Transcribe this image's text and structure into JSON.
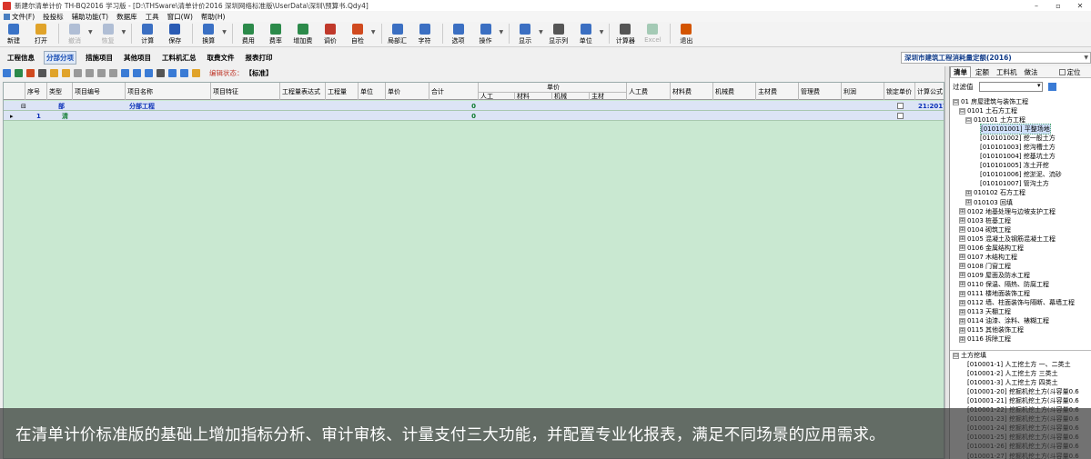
{
  "window": {
    "title": "新建尔清单计价 TH-BQ2016 学习版 - [D:\\THSware\\清单计价2016 深圳网络标准版\\UserData\\深圳\\预算书.Qdy4]",
    "controls": [
      "–",
      "▫",
      "✕"
    ]
  },
  "menu": {
    "items": [
      "文件(F)",
      "投投标",
      "辅助功能(T)",
      "数据库",
      "工具",
      "窗口(W)",
      "帮助(H)"
    ]
  },
  "toolbar": {
    "buttons": [
      {
        "label": "新建",
        "enabled": true,
        "color": "#3a73c7"
      },
      {
        "label": "打开",
        "enabled": true,
        "color": "#e0a32a"
      },
      {
        "label": "撤消",
        "enabled": false,
        "color": "#4b6fa8"
      },
      {
        "label": "恢复",
        "enabled": false,
        "color": "#4b6fa8"
      },
      {
        "label": "计算",
        "enabled": true,
        "color": "#3b6fc2"
      },
      {
        "label": "保存",
        "enabled": true,
        "color": "#2a5bb4"
      },
      {
        "label": "换算",
        "enabled": true,
        "color": "#3a70c4"
      },
      {
        "label": "费用",
        "enabled": true,
        "color": "#2c8a4a"
      },
      {
        "label": "费率",
        "enabled": true,
        "color": "#2c8a4a"
      },
      {
        "label": "增加费",
        "enabled": true,
        "color": "#2c8a4a"
      },
      {
        "label": "调价",
        "enabled": true,
        "color": "#c0392b"
      },
      {
        "label": "自检",
        "enabled": true,
        "color": "#d04a1f"
      },
      {
        "label": "局部汇",
        "enabled": true,
        "color": "#3b6fc2"
      },
      {
        "label": "字符",
        "enabled": true,
        "color": "#3b6fc2"
      },
      {
        "label": "选项",
        "enabled": true,
        "color": "#3b6fc2"
      },
      {
        "label": "操作",
        "enabled": true,
        "color": "#3b6fc2"
      },
      {
        "label": "显示",
        "enabled": true,
        "color": "#3b6fc2"
      },
      {
        "label": "显示列",
        "enabled": true,
        "color": "#555555"
      },
      {
        "label": "单位",
        "enabled": true,
        "color": "#3b6fc2"
      },
      {
        "label": "计算器",
        "enabled": true,
        "color": "#555555"
      },
      {
        "label": "Excel",
        "enabled": false,
        "color": "#2e8b57"
      },
      {
        "label": "退出",
        "enabled": true,
        "color": "#d35400"
      }
    ]
  },
  "tabs": [
    "工程信息",
    "分部分项",
    "措施项目",
    "其他项目",
    "工料机汇总",
    "取费文件",
    "报表打印"
  ],
  "active_tab": "分部分项",
  "norm_selector": {
    "value": "深圳市建筑工程消耗量定额(2016)"
  },
  "sub_toolbar": {
    "status_label": "编辑状态：",
    "status_value": "【标准】"
  },
  "grid": {
    "columns": {
      "seq": "序号",
      "type": "类型",
      "code": "项目编号",
      "name": "项目名称",
      "feature": "项目特征",
      "expr": "工程量表达式",
      "qty": "工程量",
      "unit": "单位",
      "price": "单价",
      "total": "合计",
      "group_unit_price": "单价",
      "labor": "人工",
      "material": "材料",
      "machine": "机械",
      "main_mat": "主材",
      "labor_fee": "人工费",
      "material_fee": "材料费",
      "machine_fee": "机械费",
      "main_fee": "主材费",
      "manage_fee": "管理费",
      "profit": "利润",
      "locked": "锁定单价",
      "formula": "计算公式"
    },
    "rows": [
      {
        "toggle": "⊟",
        "seq": "",
        "type": "部",
        "code": "",
        "name": "分部工程",
        "total": "0",
        "formula": "21:2017"
      },
      {
        "toggle": "",
        "seq": "1",
        "type": "清",
        "code": "",
        "name": "",
        "total": "0",
        "formula": ""
      }
    ]
  },
  "right_panel": {
    "tabs": [
      "清单",
      "定额",
      "工料机",
      "做法"
    ],
    "active_tab": "清单",
    "checkbox_label": "定位",
    "filter_label": "过滤值",
    "tree": [
      {
        "indent": 0,
        "toggle": "⊟",
        "text": "01 房屋建筑与装饰工程"
      },
      {
        "indent": 1,
        "toggle": "⊟",
        "text": "0101 土石方工程"
      },
      {
        "indent": 2,
        "toggle": "⊟",
        "text": "010101 土方工程"
      },
      {
        "indent": 3,
        "toggle": "",
        "text": "[010101001] 平整场地",
        "selected": true
      },
      {
        "indent": 3,
        "toggle": "",
        "text": "[010101002] 挖一般土方"
      },
      {
        "indent": 3,
        "toggle": "",
        "text": "[010101003] 挖沟槽土方"
      },
      {
        "indent": 3,
        "toggle": "",
        "text": "[010101004] 挖基坑土方"
      },
      {
        "indent": 3,
        "toggle": "",
        "text": "[010101005] 冻土开挖"
      },
      {
        "indent": 3,
        "toggle": "",
        "text": "[010101006] 挖淤泥、流砂"
      },
      {
        "indent": 3,
        "toggle": "",
        "text": "[010101007] 管沟土方"
      },
      {
        "indent": 2,
        "toggle": "⊞",
        "text": "010102 石方工程"
      },
      {
        "indent": 2,
        "toggle": "⊞",
        "text": "010103 回填"
      },
      {
        "indent": 1,
        "toggle": "⊞",
        "text": "0102 地基处理与边坡支护工程"
      },
      {
        "indent": 1,
        "toggle": "⊞",
        "text": "0103 桩基工程"
      },
      {
        "indent": 1,
        "toggle": "⊞",
        "text": "0104 砌筑工程"
      },
      {
        "indent": 1,
        "toggle": "⊞",
        "text": "0105 混凝土及钢筋混凝土工程"
      },
      {
        "indent": 1,
        "toggle": "⊞",
        "text": "0106 金属结构工程"
      },
      {
        "indent": 1,
        "toggle": "⊞",
        "text": "0107 木结构工程"
      },
      {
        "indent": 1,
        "toggle": "⊞",
        "text": "0108 门窗工程"
      },
      {
        "indent": 1,
        "toggle": "⊞",
        "text": "0109 屋面及防水工程"
      },
      {
        "indent": 1,
        "toggle": "⊞",
        "text": "0110 保温、隔热、防腐工程"
      },
      {
        "indent": 1,
        "toggle": "⊞",
        "text": "0111 楼地面装饰工程"
      },
      {
        "indent": 1,
        "toggle": "⊞",
        "text": "0112 墙、柱面装饰与隔断、幕墙工程"
      },
      {
        "indent": 1,
        "toggle": "⊞",
        "text": "0113 天棚工程"
      },
      {
        "indent": 1,
        "toggle": "⊞",
        "text": "0114 油漆、涂料、裱糊工程"
      },
      {
        "indent": 1,
        "toggle": "⊞",
        "text": "0115 其他装饰工程"
      },
      {
        "indent": 1,
        "toggle": "⊞",
        "text": "0116 拆除工程"
      }
    ],
    "tree2": [
      {
        "indent": 0,
        "toggle": "⊟",
        "text": "土方挖填"
      },
      {
        "indent": 1,
        "toggle": "",
        "text": "[010001-1] 人工挖土方 一、二类土"
      },
      {
        "indent": 1,
        "toggle": "",
        "text": "[010001-2] 人工挖土方 三类土"
      },
      {
        "indent": 1,
        "toggle": "",
        "text": "[010001-3] 人工挖土方 四类土"
      },
      {
        "indent": 1,
        "toggle": "",
        "text": "[010001-20] 挖掘机挖土方(斗容量0.6"
      },
      {
        "indent": 1,
        "toggle": "",
        "text": "[010001-21] 挖掘机挖土方(斗容量0.6"
      },
      {
        "indent": 1,
        "toggle": "",
        "text": "[010001-22] 挖掘机挖土方(斗容量0.6"
      },
      {
        "indent": 1,
        "toggle": "",
        "text": "[010001-23] 挖掘机挖土方(斗容量0.6"
      },
      {
        "indent": 1,
        "toggle": "",
        "text": "[010001-24] 挖掘机挖土方(斗容量0.6"
      },
      {
        "indent": 1,
        "toggle": "",
        "text": "[010001-25] 挖掘机挖土方(斗容量0.6"
      },
      {
        "indent": 1,
        "toggle": "",
        "text": "[010001-26] 挖掘机挖土方(斗容量0.6"
      },
      {
        "indent": 1,
        "toggle": "",
        "text": "[010001-27] 挖掘机挖土方(斗容量0.6"
      }
    ]
  },
  "caption": "在清单计价标准版的基础上增加指标分析、审计审核、计量支付三大功能，并配置专业化报表，满足不同场景的应用需求。"
}
